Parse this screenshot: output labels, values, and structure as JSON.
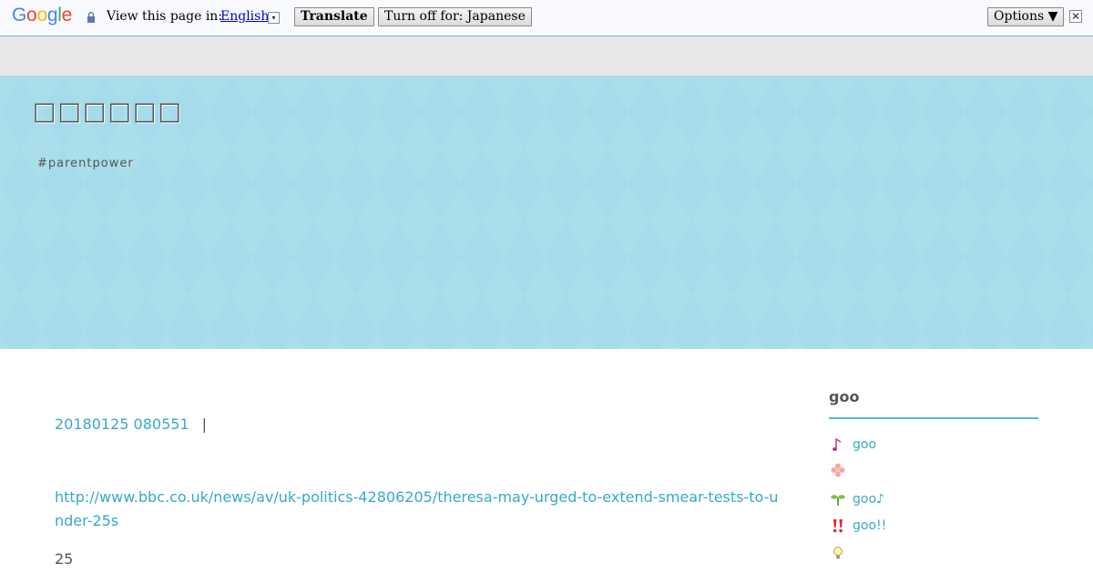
{
  "translate_bar": {
    "logo_letters": [
      "G",
      "o",
      "o",
      "g",
      "l",
      "e"
    ],
    "view_label": "View this page in:",
    "language": "English",
    "language_dropdown": "▾",
    "translate_button": "Translate",
    "turn_off_button": "Turn off for: Japanese",
    "options_button": "Options ▼",
    "close_glyph": "✕"
  },
  "header": {
    "title": "□□□□□□",
    "description": "#parentpower"
  },
  "post": {
    "date": "20180125 080551",
    "separator": "|",
    "url": "http://www.bbc.co.uk/news/av/uk-politics-42806205/theresa-may-urged-to-extend-smear-tests-to-under-25s",
    "body_number": "25"
  },
  "sidebar": {
    "heading": "goo",
    "items": [
      {
        "icon": "music-note-icon",
        "label": "goo"
      },
      {
        "icon": "flower-icon",
        "label": ""
      },
      {
        "icon": "sprout-icon",
        "label": "goo♪"
      },
      {
        "icon": "double-exclamation-icon",
        "label": "goo!!"
      },
      {
        "icon": "lightbulb-icon",
        "label": ""
      }
    ]
  },
  "colors": {
    "accent": "#38a9c6",
    "header_bg": "#a5dbea",
    "rule": "#57b9d2"
  }
}
